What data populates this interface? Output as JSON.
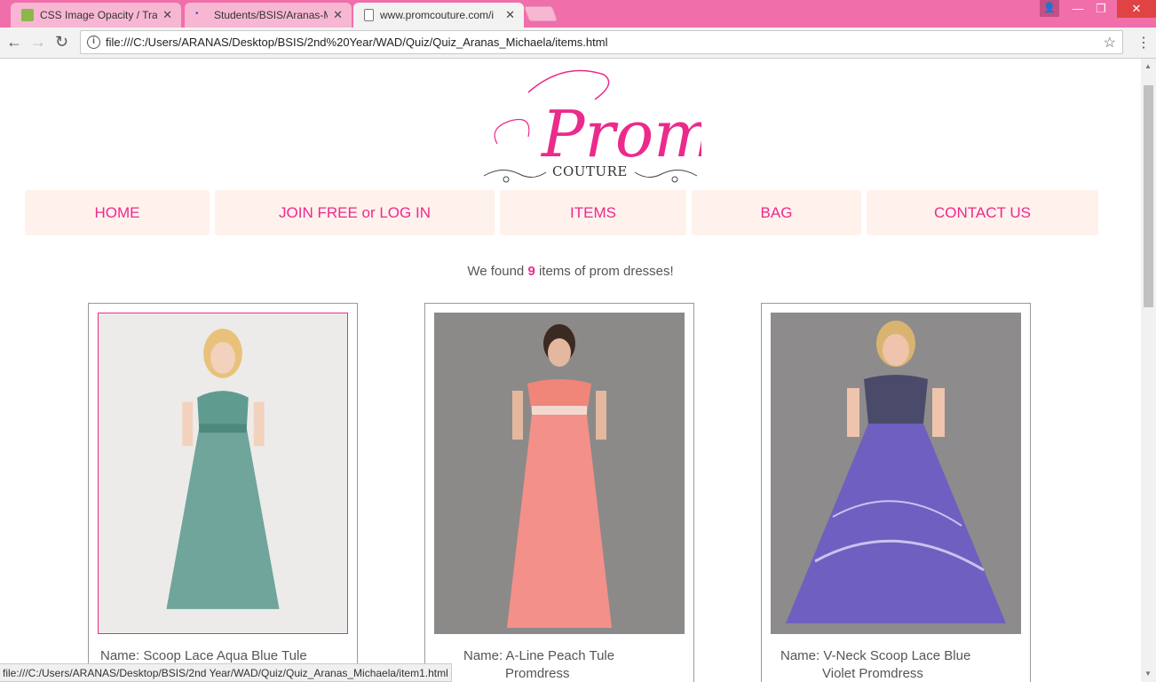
{
  "browser": {
    "tabs": [
      {
        "title": "CSS Image Opacity / Tra",
        "favicon": "w3-icon",
        "active": false
      },
      {
        "title": "Students/BSIS/Aranas-M",
        "favicon": "page-dot-icon",
        "active": false
      },
      {
        "title": "www.promcouture.com/i",
        "favicon": "document-icon",
        "active": true
      }
    ],
    "address": "file:///C:/Users/ARANAS/Desktop/BSIS/2nd%20Year/WAD/Quiz/Quiz_Aranas_Michaela/items.html",
    "status_url": "file:///C:/Users/ARANAS/Desktop/BSIS/2nd Year/WAD/Quiz/Quiz_Aranas_Michaela/item1.html",
    "chrome_color": "#f06ea9"
  },
  "logo": {
    "script": "Prom",
    "word": "COUTURE"
  },
  "nav": {
    "home": "HOME",
    "join": "JOIN FREE or LOG IN",
    "items": "ITEMS",
    "bag": "BAG",
    "contact": "CONTACT US"
  },
  "summary": {
    "prefix": "We found",
    "count": "9",
    "suffix": "items of prom dresses!"
  },
  "products": [
    {
      "label": "Name:",
      "line1": "Scoop Lace Aqua Blue Tule",
      "line2": "",
      "dress_color": "#6fa59a",
      "selected": true
    },
    {
      "label": "Name:",
      "line1": "A-Line Peach Tule",
      "line2": "Promdress",
      "dress_color": "#f0857a",
      "selected": false
    },
    {
      "label": "Name:",
      "line1": "V-Neck Scoop Lace Blue",
      "line2": "Violet Promdress",
      "dress_color": "#6f5fc0",
      "selected": false
    }
  ],
  "colors": {
    "accent": "#ec2a8c",
    "nav_bg": "#fff1ec"
  }
}
